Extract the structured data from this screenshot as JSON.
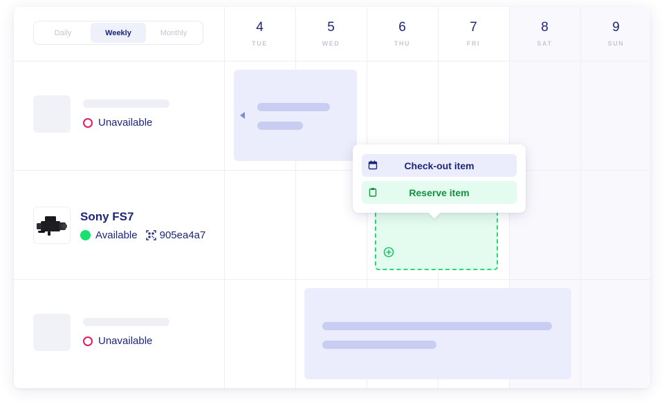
{
  "view_switch": {
    "options": [
      "Daily",
      "Weekly",
      "Monthly"
    ],
    "selected": "Weekly"
  },
  "days": [
    {
      "num": "4",
      "name": "TUE",
      "weekend": false
    },
    {
      "num": "5",
      "name": "WED",
      "weekend": false
    },
    {
      "num": "6",
      "name": "THU",
      "weekend": false
    },
    {
      "num": "7",
      "name": "FRI",
      "weekend": false
    },
    {
      "num": "8",
      "name": "SAT",
      "weekend": true
    },
    {
      "num": "9",
      "name": "SUN",
      "weekend": true
    }
  ],
  "items": [
    {
      "name": "",
      "status": "Unavailable",
      "status_color": "#e5195e",
      "code": ""
    },
    {
      "name": "Sony FS7",
      "status": "Available",
      "status_color": "#17e06e",
      "code": "905ea4a7"
    },
    {
      "name": "",
      "status": "Unavailable",
      "status_color": "#e5195e",
      "code": ""
    }
  ],
  "popover": {
    "checkout_label": "Check-out item",
    "reserve_label": "Reserve item"
  },
  "icons": {
    "checkout": "calendar-icon",
    "reserve": "clipboard-icon",
    "code": "qr-code-icon",
    "add": "plus-circle-icon",
    "collapse": "caret-left-icon"
  },
  "colors": {
    "primary_text": "#1c2577",
    "booking_fill": "#ebedfc",
    "reserve_fill": "#e4fcef",
    "reserve_text": "#12903f",
    "available": "#17e06e",
    "unavailable": "#e5195e"
  }
}
